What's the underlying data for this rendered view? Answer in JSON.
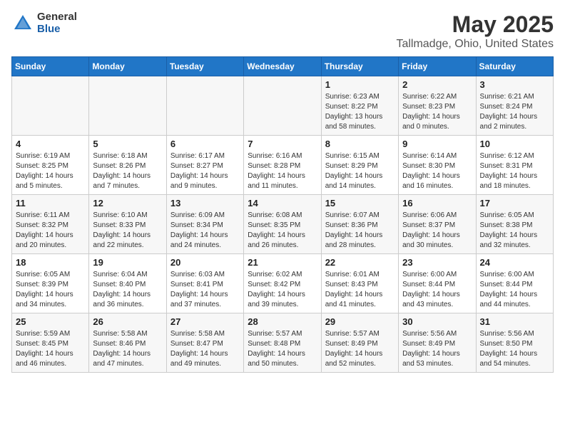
{
  "header": {
    "logo_general": "General",
    "logo_blue": "Blue",
    "main_title": "May 2025",
    "sub_title": "Tallmadge, Ohio, United States"
  },
  "days_of_week": [
    "Sunday",
    "Monday",
    "Tuesday",
    "Wednesday",
    "Thursday",
    "Friday",
    "Saturday"
  ],
  "weeks": [
    [
      {
        "num": "",
        "sunrise": "",
        "sunset": "",
        "daylight": ""
      },
      {
        "num": "",
        "sunrise": "",
        "sunset": "",
        "daylight": ""
      },
      {
        "num": "",
        "sunrise": "",
        "sunset": "",
        "daylight": ""
      },
      {
        "num": "",
        "sunrise": "",
        "sunset": "",
        "daylight": ""
      },
      {
        "num": "1",
        "sunrise": "Sunrise: 6:23 AM",
        "sunset": "Sunset: 8:22 PM",
        "daylight": "Daylight: 13 hours and 58 minutes."
      },
      {
        "num": "2",
        "sunrise": "Sunrise: 6:22 AM",
        "sunset": "Sunset: 8:23 PM",
        "daylight": "Daylight: 14 hours and 0 minutes."
      },
      {
        "num": "3",
        "sunrise": "Sunrise: 6:21 AM",
        "sunset": "Sunset: 8:24 PM",
        "daylight": "Daylight: 14 hours and 2 minutes."
      }
    ],
    [
      {
        "num": "4",
        "sunrise": "Sunrise: 6:19 AM",
        "sunset": "Sunset: 8:25 PM",
        "daylight": "Daylight: 14 hours and 5 minutes."
      },
      {
        "num": "5",
        "sunrise": "Sunrise: 6:18 AM",
        "sunset": "Sunset: 8:26 PM",
        "daylight": "Daylight: 14 hours and 7 minutes."
      },
      {
        "num": "6",
        "sunrise": "Sunrise: 6:17 AM",
        "sunset": "Sunset: 8:27 PM",
        "daylight": "Daylight: 14 hours and 9 minutes."
      },
      {
        "num": "7",
        "sunrise": "Sunrise: 6:16 AM",
        "sunset": "Sunset: 8:28 PM",
        "daylight": "Daylight: 14 hours and 11 minutes."
      },
      {
        "num": "8",
        "sunrise": "Sunrise: 6:15 AM",
        "sunset": "Sunset: 8:29 PM",
        "daylight": "Daylight: 14 hours and 14 minutes."
      },
      {
        "num": "9",
        "sunrise": "Sunrise: 6:14 AM",
        "sunset": "Sunset: 8:30 PM",
        "daylight": "Daylight: 14 hours and 16 minutes."
      },
      {
        "num": "10",
        "sunrise": "Sunrise: 6:12 AM",
        "sunset": "Sunset: 8:31 PM",
        "daylight": "Daylight: 14 hours and 18 minutes."
      }
    ],
    [
      {
        "num": "11",
        "sunrise": "Sunrise: 6:11 AM",
        "sunset": "Sunset: 8:32 PM",
        "daylight": "Daylight: 14 hours and 20 minutes."
      },
      {
        "num": "12",
        "sunrise": "Sunrise: 6:10 AM",
        "sunset": "Sunset: 8:33 PM",
        "daylight": "Daylight: 14 hours and 22 minutes."
      },
      {
        "num": "13",
        "sunrise": "Sunrise: 6:09 AM",
        "sunset": "Sunset: 8:34 PM",
        "daylight": "Daylight: 14 hours and 24 minutes."
      },
      {
        "num": "14",
        "sunrise": "Sunrise: 6:08 AM",
        "sunset": "Sunset: 8:35 PM",
        "daylight": "Daylight: 14 hours and 26 minutes."
      },
      {
        "num": "15",
        "sunrise": "Sunrise: 6:07 AM",
        "sunset": "Sunset: 8:36 PM",
        "daylight": "Daylight: 14 hours and 28 minutes."
      },
      {
        "num": "16",
        "sunrise": "Sunrise: 6:06 AM",
        "sunset": "Sunset: 8:37 PM",
        "daylight": "Daylight: 14 hours and 30 minutes."
      },
      {
        "num": "17",
        "sunrise": "Sunrise: 6:05 AM",
        "sunset": "Sunset: 8:38 PM",
        "daylight": "Daylight: 14 hours and 32 minutes."
      }
    ],
    [
      {
        "num": "18",
        "sunrise": "Sunrise: 6:05 AM",
        "sunset": "Sunset: 8:39 PM",
        "daylight": "Daylight: 14 hours and 34 minutes."
      },
      {
        "num": "19",
        "sunrise": "Sunrise: 6:04 AM",
        "sunset": "Sunset: 8:40 PM",
        "daylight": "Daylight: 14 hours and 36 minutes."
      },
      {
        "num": "20",
        "sunrise": "Sunrise: 6:03 AM",
        "sunset": "Sunset: 8:41 PM",
        "daylight": "Daylight: 14 hours and 37 minutes."
      },
      {
        "num": "21",
        "sunrise": "Sunrise: 6:02 AM",
        "sunset": "Sunset: 8:42 PM",
        "daylight": "Daylight: 14 hours and 39 minutes."
      },
      {
        "num": "22",
        "sunrise": "Sunrise: 6:01 AM",
        "sunset": "Sunset: 8:43 PM",
        "daylight": "Daylight: 14 hours and 41 minutes."
      },
      {
        "num": "23",
        "sunrise": "Sunrise: 6:00 AM",
        "sunset": "Sunset: 8:44 PM",
        "daylight": "Daylight: 14 hours and 43 minutes."
      },
      {
        "num": "24",
        "sunrise": "Sunrise: 6:00 AM",
        "sunset": "Sunset: 8:44 PM",
        "daylight": "Daylight: 14 hours and 44 minutes."
      }
    ],
    [
      {
        "num": "25",
        "sunrise": "Sunrise: 5:59 AM",
        "sunset": "Sunset: 8:45 PM",
        "daylight": "Daylight: 14 hours and 46 minutes."
      },
      {
        "num": "26",
        "sunrise": "Sunrise: 5:58 AM",
        "sunset": "Sunset: 8:46 PM",
        "daylight": "Daylight: 14 hours and 47 minutes."
      },
      {
        "num": "27",
        "sunrise": "Sunrise: 5:58 AM",
        "sunset": "Sunset: 8:47 PM",
        "daylight": "Daylight: 14 hours and 49 minutes."
      },
      {
        "num": "28",
        "sunrise": "Sunrise: 5:57 AM",
        "sunset": "Sunset: 8:48 PM",
        "daylight": "Daylight: 14 hours and 50 minutes."
      },
      {
        "num": "29",
        "sunrise": "Sunrise: 5:57 AM",
        "sunset": "Sunset: 8:49 PM",
        "daylight": "Daylight: 14 hours and 52 minutes."
      },
      {
        "num": "30",
        "sunrise": "Sunrise: 5:56 AM",
        "sunset": "Sunset: 8:49 PM",
        "daylight": "Daylight: 14 hours and 53 minutes."
      },
      {
        "num": "31",
        "sunrise": "Sunrise: 5:56 AM",
        "sunset": "Sunset: 8:50 PM",
        "daylight": "Daylight: 14 hours and 54 minutes."
      }
    ]
  ]
}
